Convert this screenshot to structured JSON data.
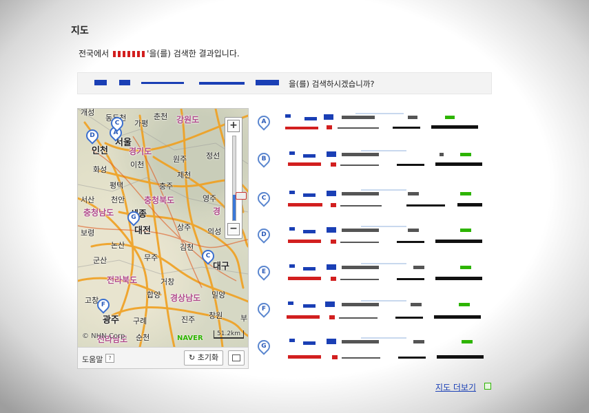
{
  "title": "지도",
  "result_line": {
    "prefix": "전국에서",
    "suffix": "'을(를) 검색한 결과입니다."
  },
  "suggest": {
    "text": "을(를) 검색하시겠습니까?"
  },
  "map": {
    "places": [
      {
        "name": "개성"
      },
      {
        "name": "동두천"
      },
      {
        "name": "춘천"
      },
      {
        "name": "가평"
      },
      {
        "name": "강원도"
      },
      {
        "name": "서울"
      },
      {
        "name": "인천"
      },
      {
        "name": "경기도"
      },
      {
        "name": "원주"
      },
      {
        "name": "정선"
      },
      {
        "name": "화성"
      },
      {
        "name": "이천"
      },
      {
        "name": "제천"
      },
      {
        "name": "평택"
      },
      {
        "name": "충주"
      },
      {
        "name": "서산"
      },
      {
        "name": "천안"
      },
      {
        "name": "충청북도"
      },
      {
        "name": "영주"
      },
      {
        "name": "충청남도"
      },
      {
        "name": "세종"
      },
      {
        "name": "경"
      },
      {
        "name": "보령"
      },
      {
        "name": "대전"
      },
      {
        "name": "상주"
      },
      {
        "name": "의성"
      },
      {
        "name": "논산"
      },
      {
        "name": "김천"
      },
      {
        "name": "군산"
      },
      {
        "name": "무주"
      },
      {
        "name": "대구"
      },
      {
        "name": "전라북도"
      },
      {
        "name": "거창"
      },
      {
        "name": "고창"
      },
      {
        "name": "합양"
      },
      {
        "name": "경상남도"
      },
      {
        "name": "밀양"
      },
      {
        "name": "광주"
      },
      {
        "name": "구례"
      },
      {
        "name": "진주"
      },
      {
        "name": "창원"
      },
      {
        "name": "부"
      },
      {
        "name": "전라남도"
      },
      {
        "name": "순천"
      }
    ],
    "pins": [
      "A",
      "C",
      "D",
      "F",
      "G"
    ],
    "zoom": {
      "plus": "+",
      "minus": "−",
      "level": 0.3
    },
    "copyright": "© NHN Corp.",
    "logo": "NAVER",
    "scale": "51.2km",
    "help": "도움말",
    "help_icon": "?",
    "reset": "초기화"
  },
  "results": [
    {
      "letter": "A"
    },
    {
      "letter": "B"
    },
    {
      "letter": "C"
    },
    {
      "letter": "D"
    },
    {
      "letter": "E"
    },
    {
      "letter": "F"
    },
    {
      "letter": "G"
    }
  ],
  "more": "지도 더보기",
  "colors": {
    "link": "#1a3fb5",
    "keyword": "#d21f1f",
    "naver": "#2db400",
    "pin": "#3a6fcf"
  }
}
